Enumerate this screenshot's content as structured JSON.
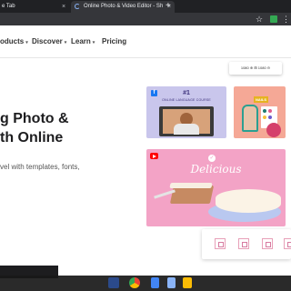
{
  "browser": {
    "tabs": [
      {
        "title": "e Tab",
        "active": false
      },
      {
        "title": "Online Photo & Video Editor - Sh",
        "active": true
      }
    ],
    "close_glyph": "×",
    "new_tab_glyph": "+",
    "star_glyph": "☆",
    "menu_glyph": "⋮",
    "accent_color": "#34a853"
  },
  "nav": {
    "items": [
      "oducts",
      "Discover",
      "Learn",
      "Pricing"
    ],
    "caret_glyph": "▾"
  },
  "hero": {
    "title_line1": "g Photo &",
    "title_line2": "th Online",
    "subtitle": "vel with templates, fonts,"
  },
  "collage": {
    "size_chip": "1080 ⊕ ⊞ 1080 ⊖",
    "course_card": {
      "platform_icon": "facebook-icon",
      "heading": "#1",
      "caption": "ONLINE LANGUAGE COURSE"
    },
    "nails_card": {
      "label": "NAILS",
      "swatch_colors": [
        "#1f7a6e",
        "#e05b8c",
        "#f3c13a",
        "#6a5acd"
      ]
    },
    "cake_card": {
      "platform_icon": "youtube-icon",
      "title": "Delicious",
      "background_color": "#f3a3c6"
    },
    "thumbnail_count": 4
  },
  "taskbar": {
    "icons": [
      "app-icon",
      "chrome-icon",
      "docs-icon",
      "slides-icon",
      "keep-icon"
    ]
  }
}
